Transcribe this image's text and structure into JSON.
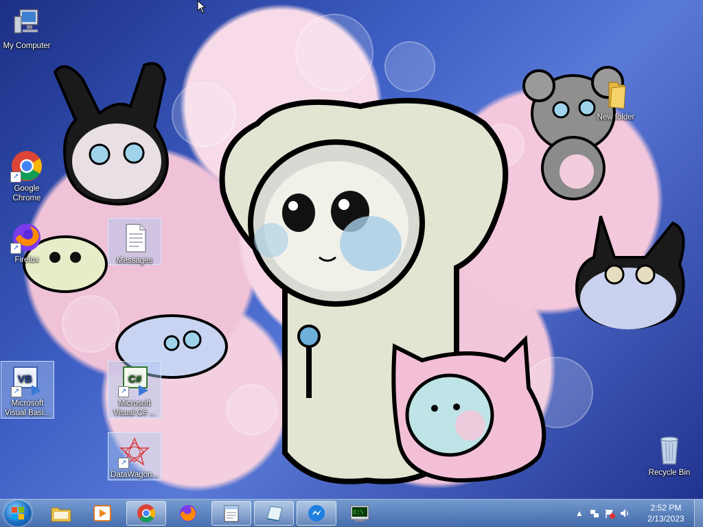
{
  "desktop": {
    "icons": [
      {
        "label": "My Computer",
        "icon": "computer-icon"
      },
      {
        "label": "Google Chrome",
        "icon": "chrome-icon"
      },
      {
        "label": "Firefox",
        "icon": "firefox-icon"
      },
      {
        "label": "Messages",
        "icon": "text-document-icon"
      },
      {
        "label": "Microsoft Visual Basi...",
        "icon": "visual-basic-icon"
      },
      {
        "label": "Microsoft Visual C# ...",
        "icon": "visual-csharp-icon"
      },
      {
        "label": "DataWagon...",
        "icon": "datawagon-icon"
      },
      {
        "label": "New folder",
        "icon": "folder-icon"
      },
      {
        "label": "Recycle Bin",
        "icon": "recycle-bin-icon"
      }
    ]
  },
  "taskbar": {
    "start": {
      "icon": "windows-logo-icon"
    },
    "pinned": [
      {
        "name": "Windows Explorer",
        "icon": "explorer-folder-icon"
      },
      {
        "name": "Windows Media Player",
        "icon": "media-player-icon"
      },
      {
        "name": "Google Chrome",
        "icon": "chrome-icon"
      },
      {
        "name": "Firefox",
        "icon": "firefox-icon"
      },
      {
        "name": "Notepad",
        "icon": "notepad-icon"
      },
      {
        "name": "Notepad Pad",
        "icon": "paper-note-icon"
      },
      {
        "name": "Messenger",
        "icon": "messenger-icon"
      },
      {
        "name": "Terminal",
        "icon": "terminal-icon"
      }
    ],
    "tray": {
      "time": "2:52 PM",
      "date": "2/13/2023"
    }
  },
  "colors": {
    "taskbar": "#5f88c0",
    "wallpaper_blue": "#2a45a8",
    "wallpaper_pink": "#f4c8dc"
  }
}
